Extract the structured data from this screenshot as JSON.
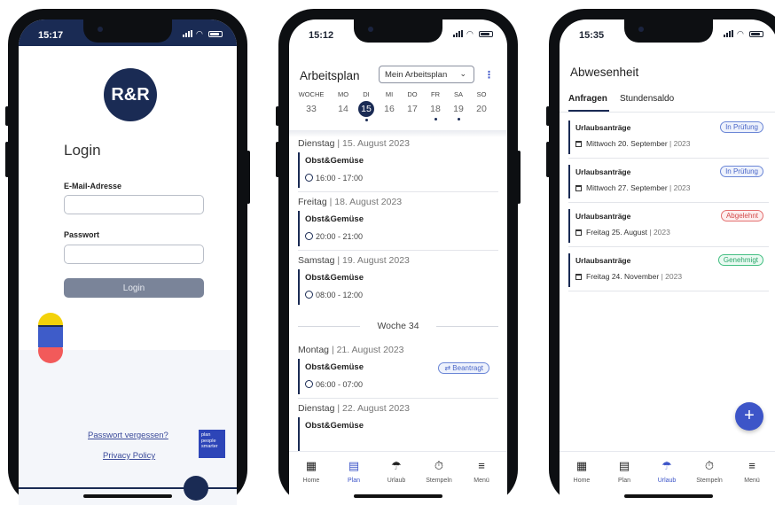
{
  "colors": {
    "navy": "#1a2b54",
    "accent": "#3d55c8",
    "pending": "#4a66c8",
    "rejected": "#d34b4b",
    "approved": "#2aa66a"
  },
  "phone1": {
    "time": "15:17",
    "logo": "R&R",
    "title": "Login",
    "email_label": "E-Mail-Adresse",
    "password_label": "Passwort",
    "login_button": "Login",
    "forgot_password": "Passwort vergessen?",
    "privacy_policy": "Privacy Policy",
    "plan_logo": "plan people smarter"
  },
  "phone2": {
    "time": "15:12",
    "title": "Arbeitsplan",
    "dropdown": "Mein Arbeitsplan",
    "week_header": {
      "label": "WOCHE",
      "number": "33"
    },
    "days": [
      {
        "h": "MO",
        "n": "14",
        "dot": false,
        "sel": false
      },
      {
        "h": "DI",
        "n": "15",
        "dot": true,
        "sel": true
      },
      {
        "h": "MI",
        "n": "16",
        "dot": false,
        "sel": false
      },
      {
        "h": "DO",
        "n": "17",
        "dot": false,
        "sel": false
      },
      {
        "h": "FR",
        "n": "18",
        "dot": true,
        "sel": false
      },
      {
        "h": "SA",
        "n": "19",
        "dot": true,
        "sel": false
      },
      {
        "h": "SO",
        "n": "20",
        "dot": false,
        "sel": false
      }
    ],
    "entries": [
      {
        "day": "Dienstag",
        "date": "15. August 2023",
        "shift": "Obst&Gemüse",
        "time": "16:00 - 17:00"
      },
      {
        "day": "Freitag",
        "date": "18. August 2023",
        "shift": "Obst&Gemüse",
        "time": "20:00 - 21:00"
      },
      {
        "day": "Samstag",
        "date": "19. August 2023",
        "shift": "Obst&Gemüse",
        "time": "08:00 - 12:00"
      },
      {
        "day": "Montag",
        "date": "21. August 2023",
        "shift": "Obst&Gemüse",
        "time": "06:00 - 07:00",
        "chip": "⇄ Beantragt"
      },
      {
        "day": "Dienstag",
        "date": "22. August 2023",
        "shift": "Obst&Gemüse",
        "time": ""
      }
    ],
    "week_divider": "Woche 34"
  },
  "phone3": {
    "time": "15:35",
    "title": "Abwesenheit",
    "tabs": [
      "Anfragen",
      "Stundensaldo"
    ],
    "requests": [
      {
        "type": "Urlaubsanträge",
        "date": "Mittwoch 20. September",
        "year": "2023",
        "status": "In Prüfung",
        "kind": "pr"
      },
      {
        "type": "Urlaubsanträge",
        "date": "Mittwoch 27. September",
        "year": "2023",
        "status": "In Prüfung",
        "kind": "pr"
      },
      {
        "type": "Urlaubsanträge",
        "date": "Freitag 25. August",
        "year": "2023",
        "status": "Abgelehnt",
        "kind": "ab"
      },
      {
        "type": "Urlaubsanträge",
        "date": "Freitag 24. November",
        "year": "2023",
        "status": "Genehmigt",
        "kind": "ge"
      }
    ],
    "fab": "+"
  },
  "tabbar": [
    {
      "label": "Home",
      "icon": "grid-icon",
      "glyph": "▦"
    },
    {
      "label": "Plan",
      "icon": "calendar-icon",
      "glyph": "▤"
    },
    {
      "label": "Urlaub",
      "icon": "umbrella-icon",
      "glyph": "☂"
    },
    {
      "label": "Stempeln",
      "icon": "stopwatch-icon",
      "glyph": "⏱"
    },
    {
      "label": "Menü",
      "icon": "menu-icon",
      "glyph": "≡"
    }
  ]
}
